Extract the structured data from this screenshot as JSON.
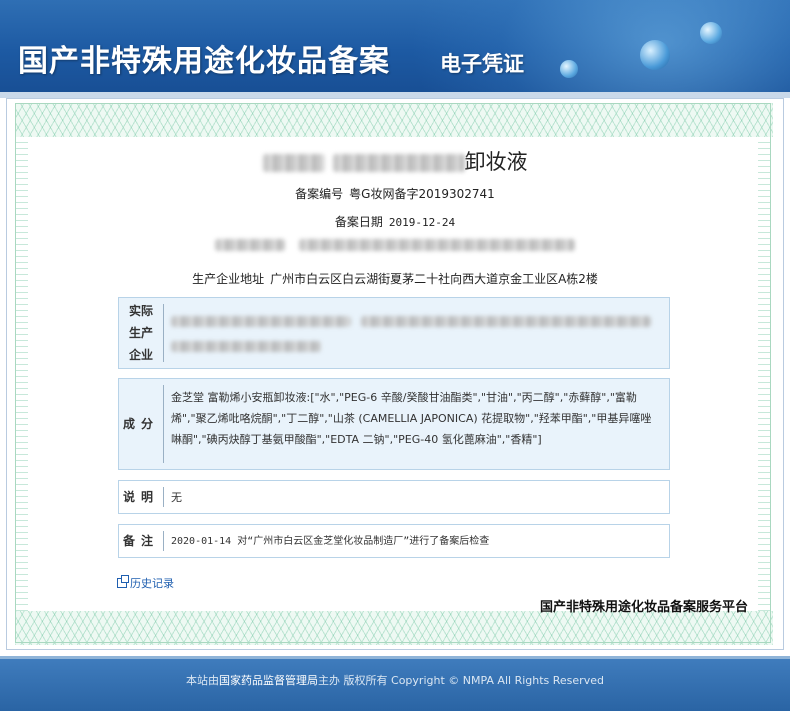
{
  "header": {
    "title": "国产非特殊用途化妆品备案",
    "subtitle": "电子凭证"
  },
  "product": {
    "name_suffix": "卸妆液"
  },
  "record": {
    "number_label": "备案编号",
    "number_value": "粤G妆网备字2019302741",
    "date_label": "备案日期",
    "date_value": "2019-12-24",
    "address_label": "生产企业地址",
    "address_value": "广州市白云区白云湖街夏茅二十社向西大道京金工业区A栋2楼"
  },
  "boxes": {
    "manufacturer": {
      "label": "实际生产企业"
    },
    "ingredients": {
      "label": "成分",
      "text": "金芝堂 富勒烯小安瓶卸妆液:[\"水\",\"PEG-6 辛酸/癸酸甘油酯类\",\"甘油\",\"丙二醇\",\"赤藓醇\",\"富勒烯\",\"聚乙烯吡咯烷酮\",\"丁二醇\",\"山茶 (CAMELLIA JAPONICA) 花提取物\",\"羟苯甲酯\",\"甲基异噻唑啉酮\",\"碘丙炔醇丁基氨甲酸酯\",\"EDTA 二钠\",\"PEG-40 氢化蓖麻油\",\"香精\"]"
    },
    "description": {
      "label": "说明",
      "text": "无"
    },
    "remark": {
      "label": "备注",
      "text": "2020-01-14 对“广州市白云区金芝堂化妆品制造厂”进行了备案后检查"
    }
  },
  "links": {
    "history": "历史记录"
  },
  "platform": "国产非特殊用途化妆品备案服务平台",
  "footer": {
    "prefix": "本站由",
    "org": "国家药品监督管理局",
    "suffix": "主办 版权所有 Copyright © NMPA All Rights Reserved"
  }
}
